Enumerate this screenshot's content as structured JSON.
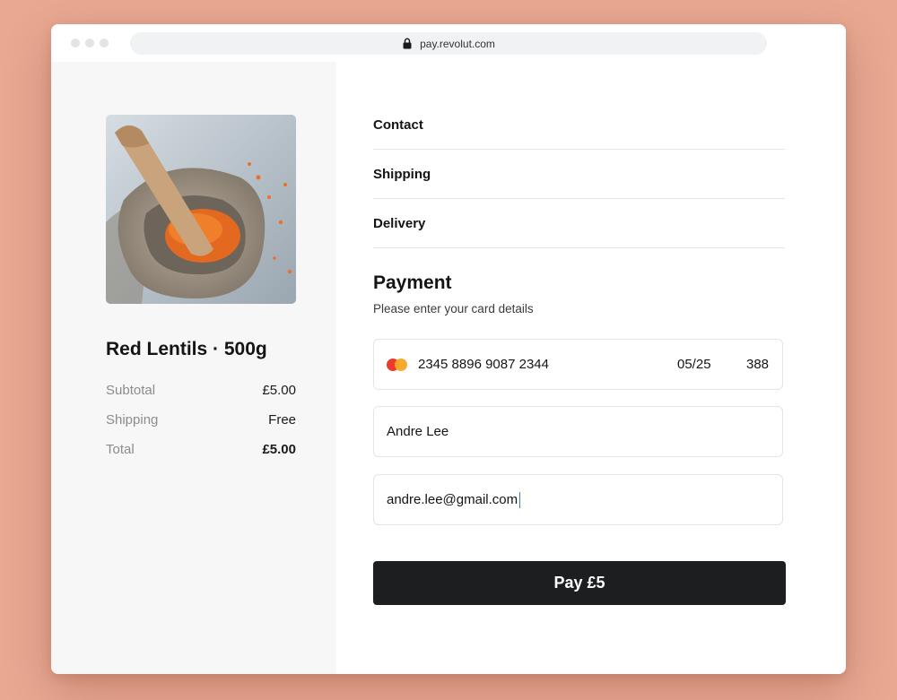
{
  "browser": {
    "url": "pay.revolut.com"
  },
  "product": {
    "title": "Red Lentils · 500g",
    "image_description_icon": "lentils-in-sack-image",
    "summary": [
      {
        "label": "Subtotal",
        "value": "£5.00",
        "bold": false
      },
      {
        "label": "Shipping",
        "value": "Free",
        "bold": false
      },
      {
        "label": "Total",
        "value": "£5.00",
        "bold": true
      }
    ]
  },
  "checkout": {
    "sections": [
      "Contact",
      "Shipping",
      "Delivery"
    ],
    "payment_title": "Payment",
    "payment_subtitle": "Please enter your card details",
    "card_number": "2345 8896 9087 2344",
    "card_expiry": "05/25",
    "card_cvc": "388",
    "card_brand_icon": "mastercard-icon",
    "name": "Andre Lee",
    "email": "andre.lee@gmail.com",
    "pay_button": "Pay £5"
  },
  "colors": {
    "background": "#e8a892",
    "pay_button": "#1c1e20",
    "left_panel": "#f7f7f7"
  }
}
